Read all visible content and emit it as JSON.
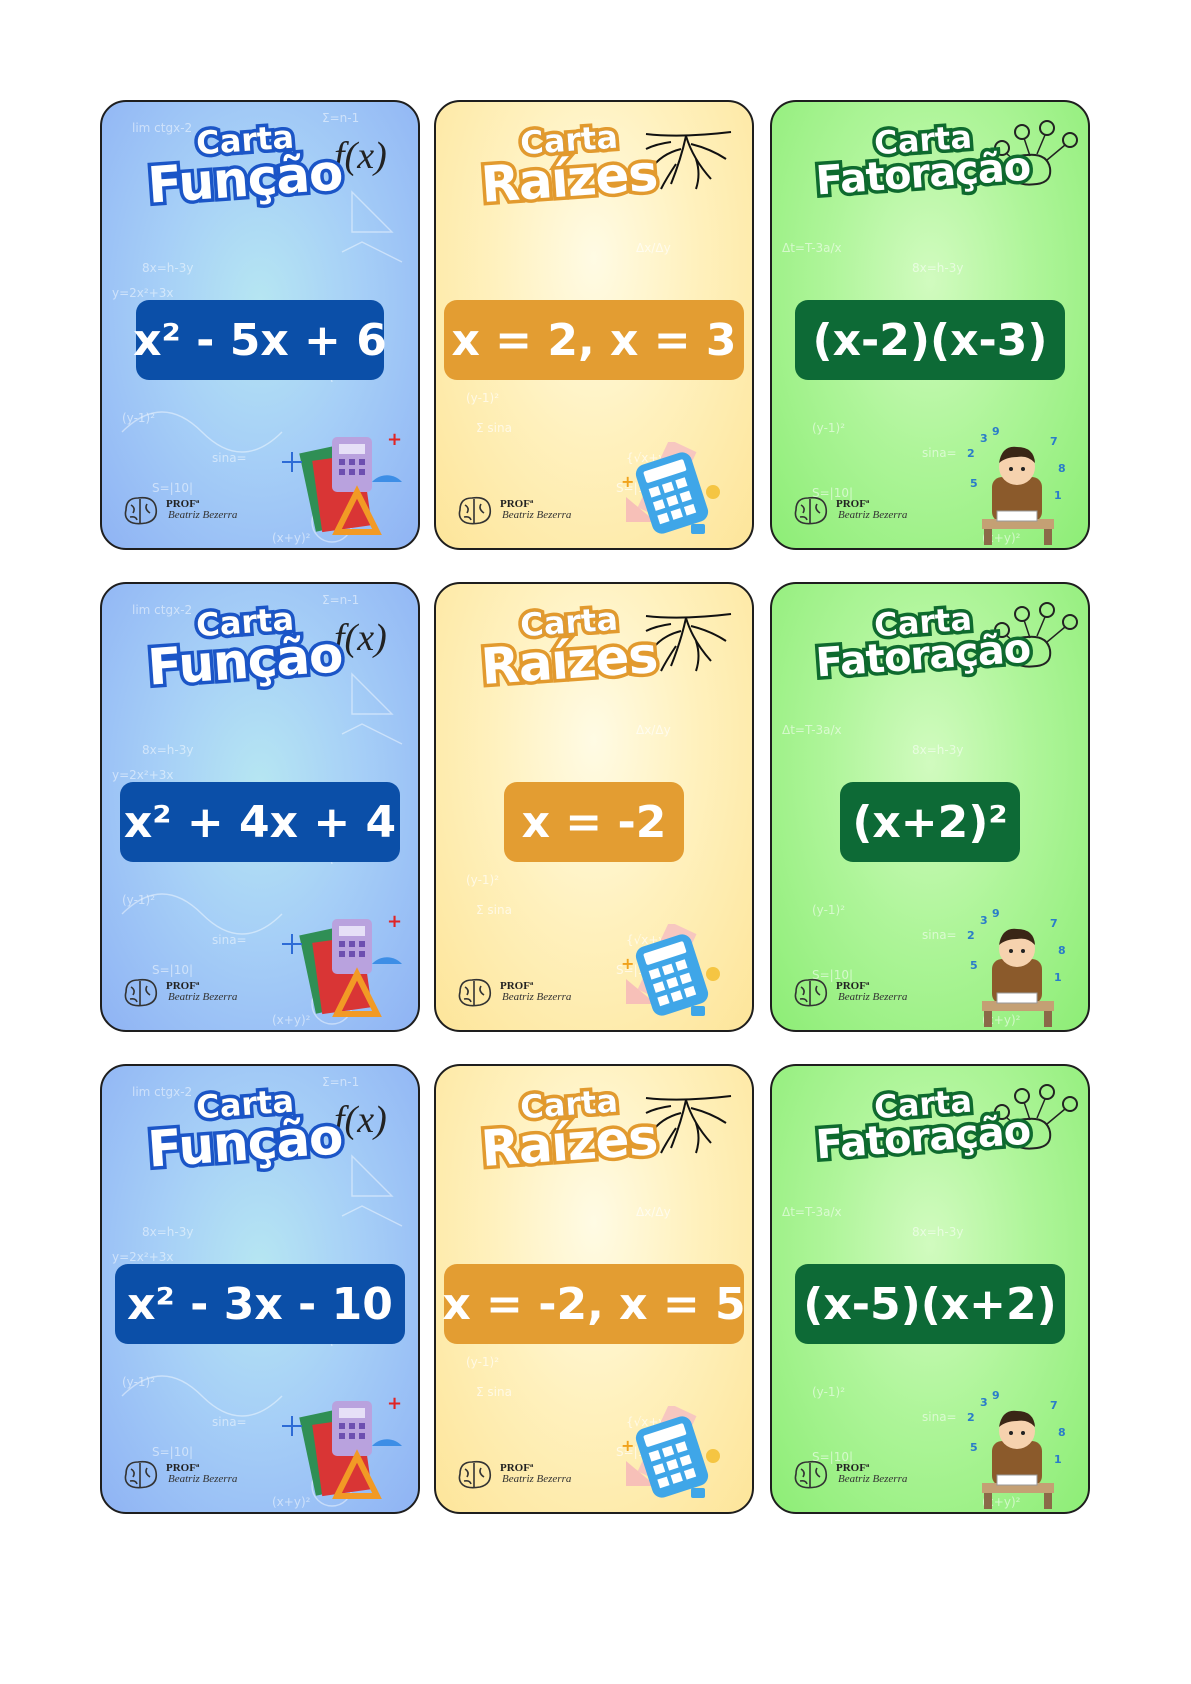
{
  "brand": {
    "prof": "PROFª",
    "signature": "Beatriz Bezerra"
  },
  "fx_mark": "f(x)",
  "card_titles": {
    "funcao": {
      "line1": "Carta",
      "line2": "Função"
    },
    "raizes": {
      "line1": "Carta",
      "line2": "Raízes"
    },
    "fatoracao": {
      "line1": "Carta",
      "line2": "Fatoração"
    }
  },
  "rows": [
    {
      "funcao": "x² - 5x + 6",
      "raizes": "x = 2, x = 3",
      "fatoracao": "(x-2)(x-3)"
    },
    {
      "funcao": "x² + 4x + 4",
      "raizes": "x = -2",
      "fatoracao": "(x+2)²"
    },
    {
      "funcao": "x² - 3x - 10",
      "raizes": "x = -2, x = 5",
      "fatoracao": "(x-5)(x+2)"
    }
  ],
  "colors": {
    "funcao_box": "#0b4fa8",
    "raizes_box": "#e39d32",
    "fatoracao_box": "#0d6a36"
  },
  "icons": [
    "brain-icon",
    "math-books-calculator-icon",
    "calculator-ruler-icon",
    "student-studying-icon",
    "roots-icon",
    "brain-symbols-icon"
  ]
}
